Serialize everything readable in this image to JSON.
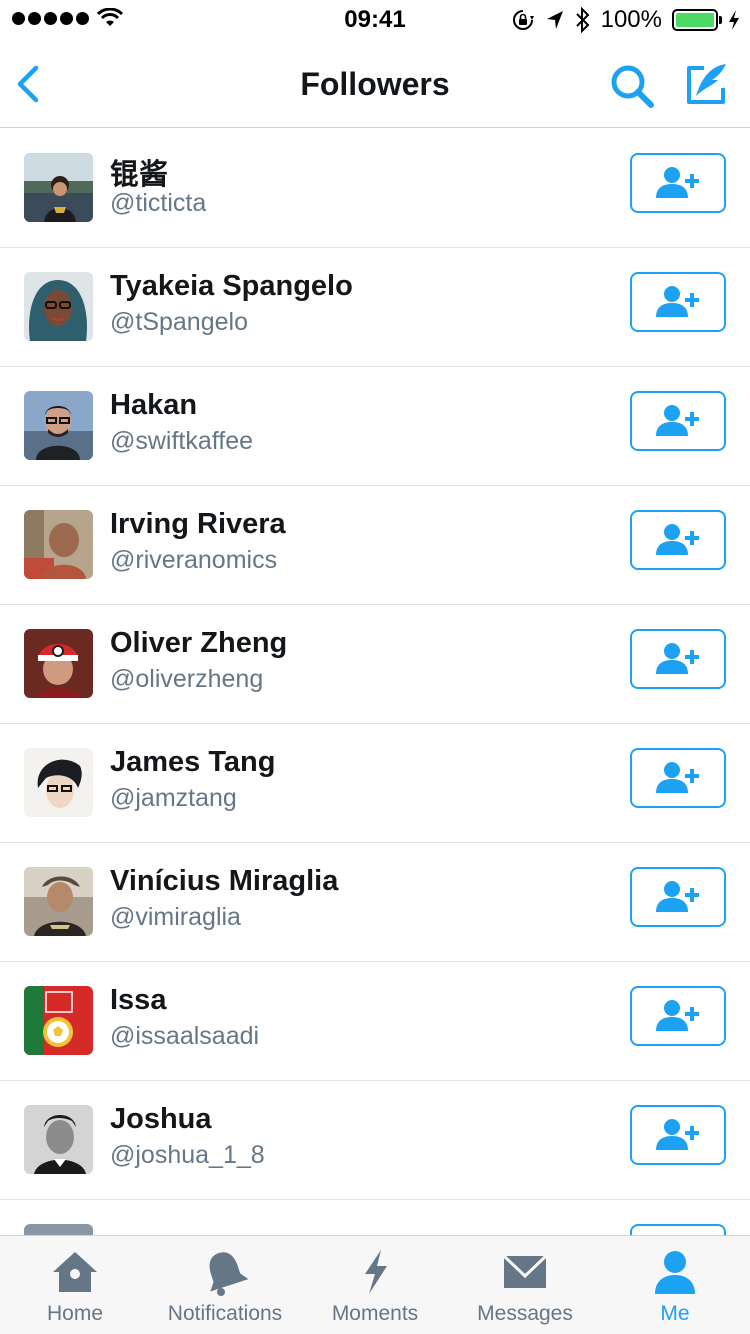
{
  "status_bar": {
    "time": "09:41",
    "battery_percent": "100%",
    "battery_level": 1.0,
    "battery_color": "#4cd964"
  },
  "nav": {
    "title": "Followers",
    "back_icon": "chevron-left-icon",
    "search_icon": "search-icon",
    "compose_icon": "compose-tweet-icon",
    "accent": "#1da1f2"
  },
  "followers": [
    {
      "name": "锟酱",
      "handle": "@ticticta",
      "avatar_color": "#5a6b7d"
    },
    {
      "name": "Tyakeia Spangelo",
      "handle": "@tSpangelo",
      "avatar_color": "#3e6e7a"
    },
    {
      "name": "Hakan",
      "handle": "@swiftkaffee",
      "avatar_color": "#7b95b8"
    },
    {
      "name": "Irving Rivera",
      "handle": "@riveranomics",
      "avatar_color": "#9a7a5e"
    },
    {
      "name": "Oliver Zheng",
      "handle": "@oliverzheng",
      "avatar_color": "#8a2e28"
    },
    {
      "name": "James Tang",
      "handle": "@jamztang",
      "avatar_color": "#e8e4e0"
    },
    {
      "name": "Vinícius Miraglia",
      "handle": "@vimiraglia",
      "avatar_color": "#8a7a6a"
    },
    {
      "name": "Issa",
      "handle": "@issaalsaadi",
      "avatar_color": "#d62a28"
    },
    {
      "name": "Joshua",
      "handle": "@joshua_1_8",
      "avatar_color": "#c8c8c8"
    },
    {
      "name": "",
      "handle": "",
      "avatar_color": "#8a96a3"
    }
  ],
  "follow_button_icon": "add-user-icon",
  "tabs": [
    {
      "label": "Home",
      "icon": "home-icon",
      "active": false
    },
    {
      "label": "Notifications",
      "icon": "bell-icon",
      "active": false
    },
    {
      "label": "Moments",
      "icon": "lightning-icon",
      "active": false
    },
    {
      "label": "Messages",
      "icon": "envelope-icon",
      "active": false
    },
    {
      "label": "Me",
      "icon": "person-icon",
      "active": true
    }
  ],
  "colors": {
    "tab_inactive": "#657786",
    "tab_active": "#1da1f2",
    "handle": "#657786"
  }
}
